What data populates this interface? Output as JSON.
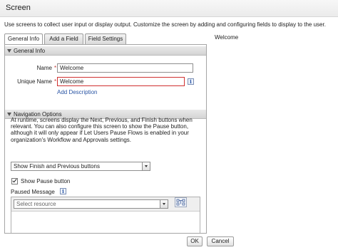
{
  "window": {
    "title": "Screen"
  },
  "intro_text": "Use screens to collect user input or display output. Customize the screen by adding and configuring fields to display to the user.",
  "tabs": [
    {
      "label": "General Info"
    },
    {
      "label": "Add a Field"
    },
    {
      "label": "Field Settings"
    }
  ],
  "general_info": {
    "header": "General Info",
    "name_label": "Name",
    "name_value": "Welcome",
    "unique_name_label": "Unique Name",
    "unique_name_value": "Welcome",
    "info_glyph": "i",
    "add_description": "Add Description"
  },
  "navigation": {
    "header": "Navigation Options",
    "description": "At runtime, screens display the Next, Previous, and Finish buttons when relevant. You can also configure this screen to show the Pause button, although it will only appear if Let Users Pause Flows is enabled in your organization's Workflow and Approvals settings.",
    "buttons_select_value": "Show Finish and Previous buttons",
    "show_pause_label": "Show Pause button",
    "show_pause_checked": true,
    "paused_message_label": "Paused Message",
    "resource_placeholder": "Select resource"
  },
  "preview": {
    "title": "Welcome"
  },
  "footer": {
    "ok_label": "OK",
    "cancel_label": "Cancel"
  },
  "colors": {
    "required": "#c23934",
    "link": "#2a55a4",
    "error_border": "#d03030"
  },
  "icons": {
    "info": "info-icon",
    "collapse": "collapse-triangle-icon",
    "dropdown": "chevron-down-icon",
    "resource_picker": "resource-picker-icon"
  }
}
